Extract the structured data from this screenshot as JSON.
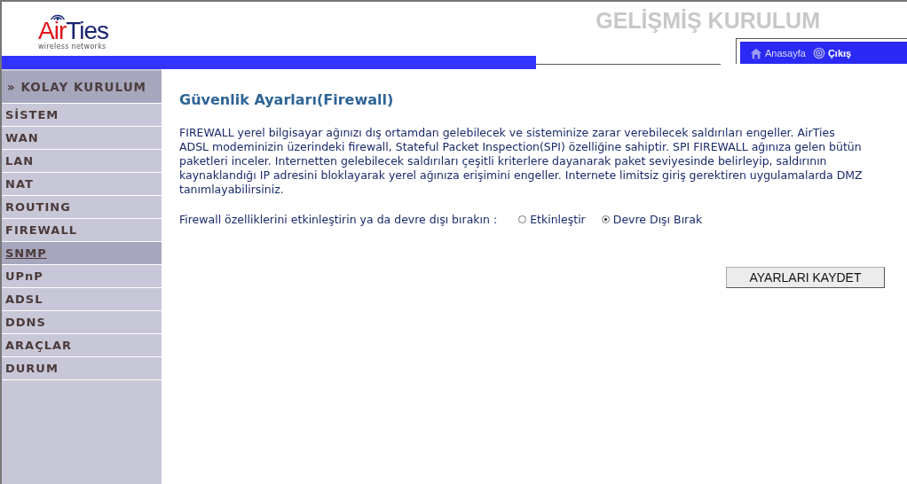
{
  "logo": {
    "parts": [
      "Air",
      "Ties"
    ],
    "tagline": "wireless networks"
  },
  "header": {
    "title": "GELİŞMİŞ KURULUM",
    "nav": [
      {
        "kind": "home",
        "label": "Anasayfa"
      },
      {
        "kind": "exit",
        "label": "Çıkış"
      }
    ]
  },
  "sidebar": {
    "heading": "» KOLAY KURULUM",
    "items": [
      {
        "label": "SİSTEM",
        "selected": false
      },
      {
        "label": "WAN",
        "selected": false
      },
      {
        "label": "LAN",
        "selected": false
      },
      {
        "label": "NAT",
        "selected": false
      },
      {
        "label": "ROUTING",
        "selected": false
      },
      {
        "label": "FIREWALL",
        "selected": false
      },
      {
        "label": "SNMP",
        "selected": true
      },
      {
        "label": "UPnP",
        "selected": false
      },
      {
        "label": "ADSL",
        "selected": false
      },
      {
        "label": "DDNS",
        "selected": false
      },
      {
        "label": "ARAÇLAR",
        "selected": false
      },
      {
        "label": "DURUM",
        "selected": false
      }
    ]
  },
  "content": {
    "title": "Güvenlik Ayarları(Firewall)",
    "description": "FIREWALL yerel bilgisayar ağınızı dış ortamdan gelebilecek ve sisteminize zarar verebilecek saldırıları engeller. AirTies ADSL modeminizin üzerindeki firewall, Stateful Packet Inspection(SPI) özelliğine sahiptir. SPI FIREWALL ağınıza gelen bütün paketleri inceler. Internetten gelebilecek saldırıları çeşitli kriterlere dayanarak paket seviyesinde belirleyip, saldırının kaynaklandığı IP adresini bloklayarak yerel ağınıza erişimini engeller. Internete limitsiz giriş gerektiren uygulamalarda DMZ tanımlayabilirsiniz.",
    "option_label": "Firewall özelliklerini etkinleştirin ya da devre dışı bırakın :",
    "options": [
      {
        "label": "Etkinleştir",
        "selected": false
      },
      {
        "label": "Devre Dışı Bırak",
        "selected": true
      }
    ],
    "save_button": "AYARLARI KAYDET"
  }
}
